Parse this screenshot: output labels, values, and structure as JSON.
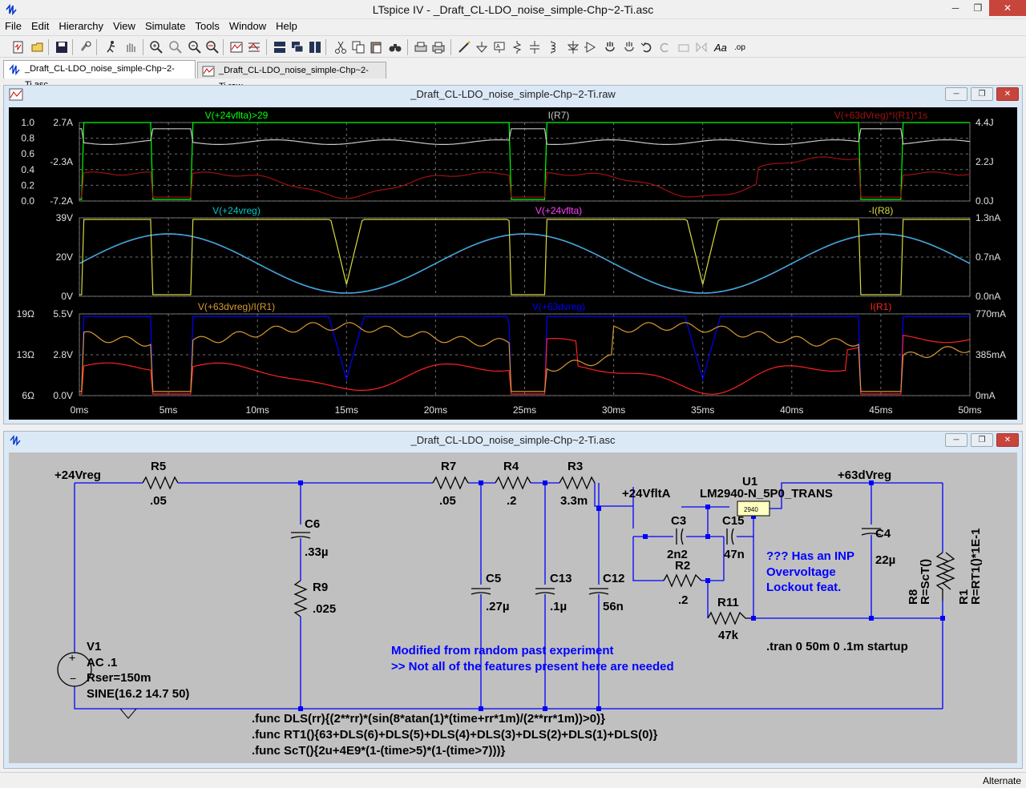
{
  "app": {
    "title": "LTspice IV - _Draft_CL-LDO_noise_simple-Chp~2-Ti.asc",
    "min": "─",
    "max": "❐",
    "close": "✕"
  },
  "menu": [
    "File",
    "Edit",
    "Hierarchy",
    "View",
    "Simulate",
    "Tools",
    "Window",
    "Help"
  ],
  "tabs": [
    {
      "label": "_Draft_CL-LDO_noise_simple-Chp~2-Ti.asc",
      "active": true
    },
    {
      "label": "_Draft_CL-LDO_noise_simple-Chp~2-Ti.raw",
      "active": false
    }
  ],
  "waveform_window": {
    "title": "_Draft_CL-LDO_noise_simple-Chp~2-Ti.raw"
  },
  "schematic_window": {
    "title": "_Draft_CL-LDO_noise_simple-Chp~2-Ti.asc"
  },
  "status": "Alternate",
  "colors": {
    "plot_bg": "#000000",
    "schematic_bg": "#c0c0c0",
    "wire": "#0000ff",
    "green": "#00ff00",
    "gray": "#c8c8c8",
    "darkred": "#a01010",
    "cyan": "#00c8c8",
    "magenta": "#ff40ff",
    "yellow": "#d8d840",
    "orange": "#d89a30",
    "blue": "#0000ff",
    "red": "#ff2020"
  },
  "chart_data": {
    "type": "line",
    "x_axis": {
      "ticks": [
        "0ms",
        "5ms",
        "10ms",
        "15ms",
        "20ms",
        "25ms",
        "30ms",
        "35ms",
        "40ms",
        "45ms",
        "50ms"
      ],
      "range": [
        0,
        50
      ],
      "unit": "ms"
    },
    "panes": [
      {
        "traces": [
          {
            "name": "V(+24vflta)>29",
            "color": "green"
          },
          {
            "name": "I(R7)",
            "color": "gray"
          },
          {
            "name": "V(+63dVreg)*I(R1)*1s",
            "color": "darkred"
          }
        ],
        "left1_ticks": [
          "1.0",
          "0.8",
          "0.6",
          "0.4",
          "0.2",
          "0.0"
        ],
        "left2_ticks": [
          "2.7A",
          "-2.3A",
          "-7.2A"
        ],
        "right_ticks": [
          "4.4J",
          "2.2J",
          "0.0J"
        ]
      },
      {
        "traces": [
          {
            "name": "V(+24vreg)",
            "color": "cyan"
          },
          {
            "name": "V(+24vflta)",
            "color": "magenta"
          },
          {
            "name": "-I(R8)",
            "color": "yellow"
          }
        ],
        "left_ticks": [
          "39V",
          "20V",
          "0V"
        ],
        "right_ticks": [
          "1.3nA",
          "0.7nA",
          "0.0nA"
        ]
      },
      {
        "traces": [
          {
            "name": "V(+63dvreg)/I(R1)",
            "color": "orange"
          },
          {
            "name": "V(+63dvreg)",
            "color": "blue"
          },
          {
            "name": "I(R1)",
            "color": "red"
          }
        ],
        "left1_ticks": [
          "19Ω",
          "13Ω",
          "6Ω"
        ],
        "left2_ticks": [
          "5.5V",
          "2.8V",
          "0.0V"
        ],
        "right_ticks": [
          "770mA",
          "385mA",
          "0mA"
        ]
      }
    ]
  },
  "schematic": {
    "nets": {
      "n24vreg": "+24Vreg",
      "n24vflta": "+24VfltA",
      "n63": "+63dVreg"
    },
    "components": {
      "r5": {
        "ref": "R5",
        "val": ".05"
      },
      "r7": {
        "ref": "R7",
        "val": ".05"
      },
      "r4": {
        "ref": "R4",
        "val": ".2"
      },
      "r3": {
        "ref": "R3",
        "val": "3.3m"
      },
      "c6": {
        "ref": "C6",
        "val": ".33µ"
      },
      "r9": {
        "ref": "R9",
        "val": ".025"
      },
      "c5": {
        "ref": "C5",
        "val": ".27µ"
      },
      "c13": {
        "ref": "C13",
        "val": ".1µ"
      },
      "c12": {
        "ref": "C12",
        "val": "56n"
      },
      "c3": {
        "ref": "C3",
        "val": "2n2"
      },
      "c15": {
        "ref": "C15",
        "val": "47n"
      },
      "r2": {
        "ref": "R2",
        "val": ".2"
      },
      "r11": {
        "ref": "R11",
        "val": "47k"
      },
      "c4": {
        "ref": "C4",
        "val": "22µ"
      },
      "u1": {
        "ref": "U1",
        "val": "LM2940-N_5P0_TRANS",
        "chip": "2940"
      },
      "r8": {
        "ref": "R8",
        "val": "R=ScT()"
      },
      "r1": {
        "ref": "R1",
        "val": "R=RT1()*1E-1"
      },
      "v1": {
        "ref": "V1",
        "lines": [
          "AC .1",
          "Rser=150m",
          "SINE(16.2 14.7 50)"
        ]
      }
    },
    "comment_uv": [
      "??? Has an INP",
      "Overvoltage",
      "Lockout feat."
    ],
    "comment_mod": [
      "Modified from random past experiment",
      ">> Not all of the features present here are needed"
    ],
    "directives": [
      ".tran 0 50m 0 .1m startup",
      ".func DLS(rr){(2**rr)*(sin(8*atan(1)*(time+rr*1m)/(2**rr*1m))>0)}",
      ".func RT1(){63+DLS(6)+DLS(5)+DLS(4)+DLS(3)+DLS(2)+DLS(1)+DLS(0)}",
      ".func ScT(){2u+4E9*(1-(time>5)*(1-(time>7)))}"
    ]
  }
}
